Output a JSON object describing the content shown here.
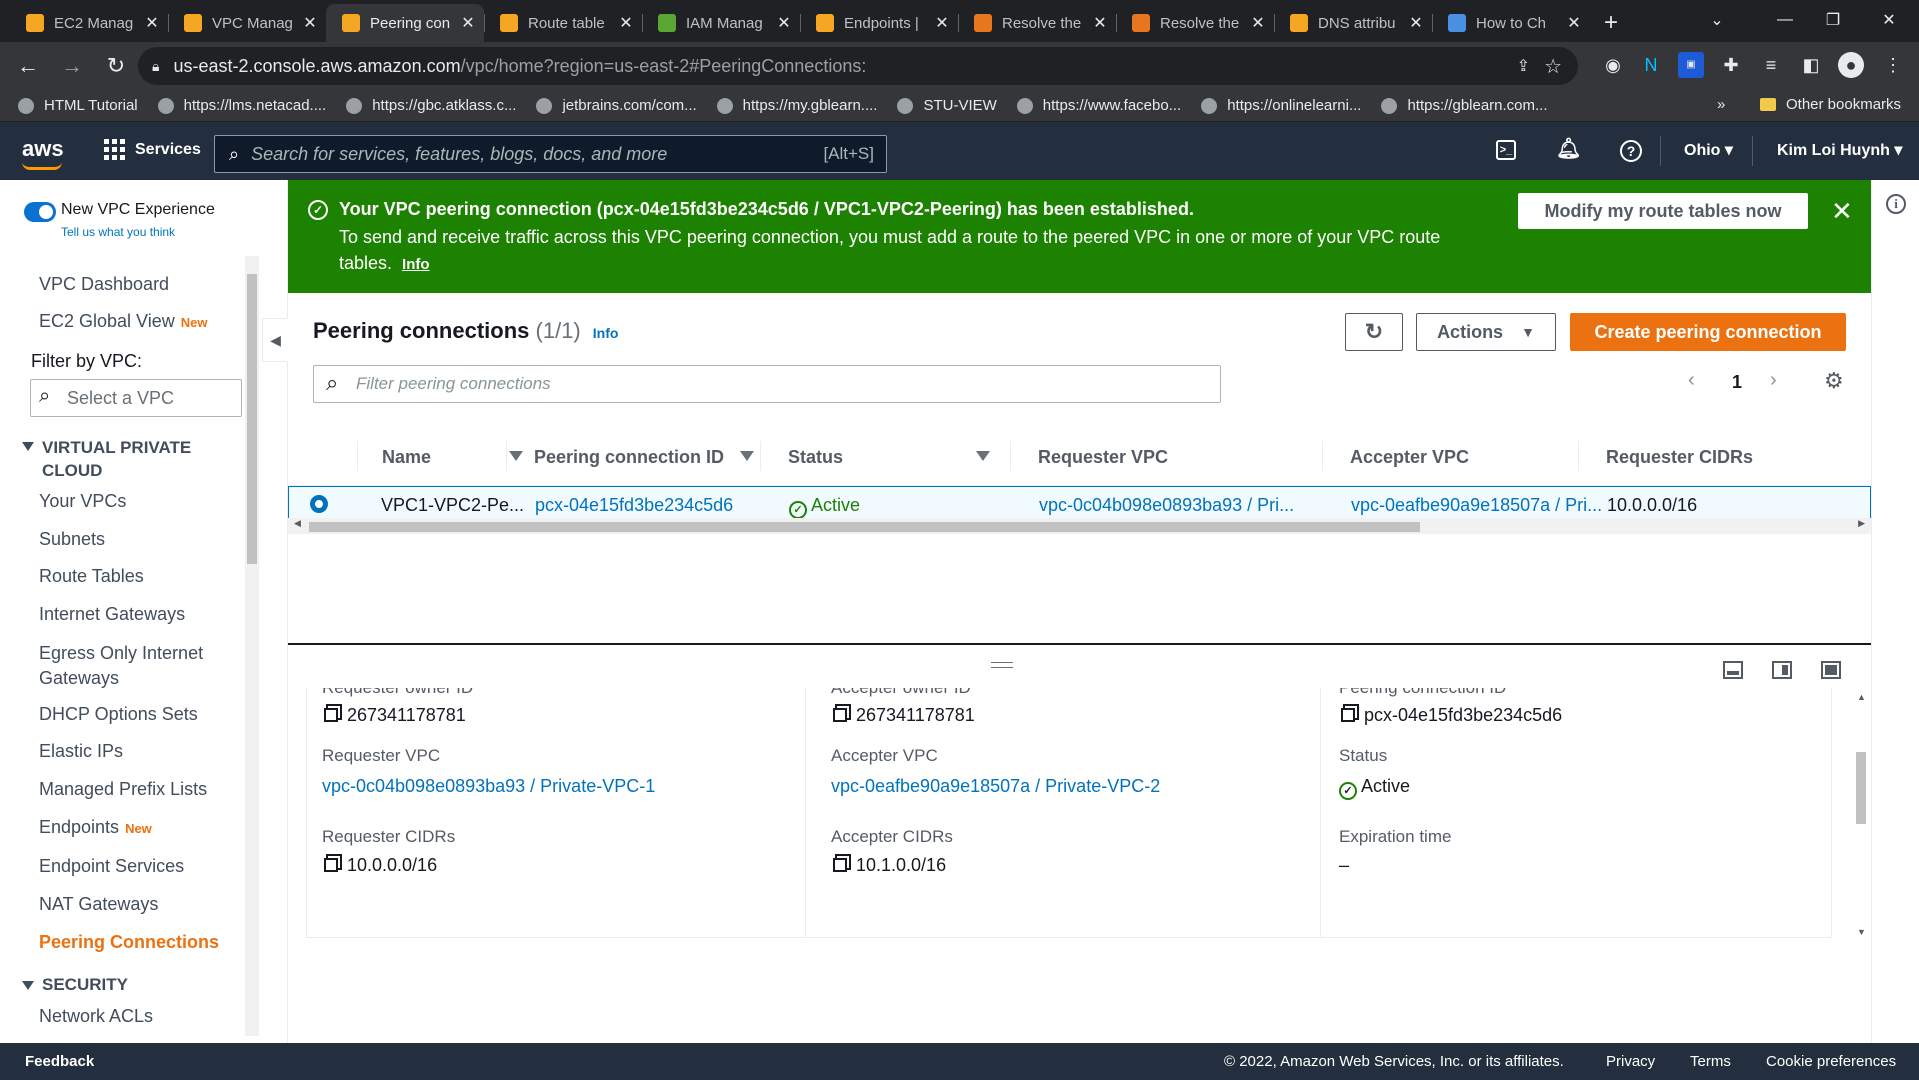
{
  "browser": {
    "tabs": [
      {
        "title": "EC2 Manag",
        "color": "#f5a623"
      },
      {
        "title": "VPC Manag",
        "color": "#f5a623"
      },
      {
        "title": "Peering con",
        "color": "#f5a623",
        "active": true
      },
      {
        "title": "Route table",
        "color": "#f5a623"
      },
      {
        "title": "IAM Manag",
        "color": "#5aa832"
      },
      {
        "title": "Endpoints |",
        "color": "#f5a623"
      },
      {
        "title": "Resolve the",
        "color": "#e8761f"
      },
      {
        "title": "Resolve the",
        "color": "#e8761f"
      },
      {
        "title": "DNS attribu",
        "color": "#f5a623"
      },
      {
        "title": "How to Ch",
        "color": "#4a90e2"
      }
    ],
    "url_host": "us-east-2.console.aws.amazon.com",
    "url_path": "/vpc/home?region=us-east-2#PeeringConnections:",
    "bookmarks": [
      "HTML Tutorial",
      "https://lms.netacad....",
      "https://gbc.atklass.c...",
      "jetbrains.com/com...",
      "https://my.gblearn....",
      "STU-VIEW",
      "https://www.facebo...",
      "https://onlinelearni...",
      "https://gblearn.com..."
    ],
    "other_bookmarks": "Other bookmarks",
    "more_chevron": "»"
  },
  "aws_nav": {
    "logo": "aws",
    "services": "Services",
    "search_placeholder": "Search for services, features, blogs, docs, and more",
    "search_shortcut": "[Alt+S]",
    "region": "Ohio",
    "user": "Kim Loi Huynh"
  },
  "sidebar": {
    "new_vpc_experience": "New VPC Experience",
    "feedback_link": "Tell us what you think",
    "dashboard": "VPC Dashboard",
    "ec2_global_view": "EC2 Global View",
    "new_badge": "New",
    "filter_label": "Filter by VPC:",
    "filter_placeholder": "Select a VPC",
    "section_vpc_line1": "VIRTUAL PRIVATE",
    "section_vpc_line2": "CLOUD",
    "items": [
      "Your VPCs",
      "Subnets",
      "Route Tables",
      "Internet Gateways",
      "Egress Only Internet",
      "Gateways",
      "DHCP Options Sets",
      "Elastic IPs",
      "Managed Prefix Lists",
      "Endpoints",
      "Endpoint Services",
      "NAT Gateways",
      "Peering Connections"
    ],
    "section_security": "SECURITY",
    "security_items": [
      "Network ACLs"
    ]
  },
  "flash": {
    "title": "Your VPC peering connection (pcx-04e15fd3be234c5d6 / VPC1-VPC2-Peering) has been established.",
    "message": "To send and receive traffic across this VPC peering connection, you must add a route to the peered VPC in one or more of your VPC route tables.",
    "info": "Info",
    "action": "Modify my route tables now",
    "color": "#1d8102"
  },
  "page": {
    "title": "Peering connections",
    "count": "(1/1)",
    "info": "Info",
    "actions": "Actions",
    "create": "Create peering connection",
    "filter_placeholder": "Filter peering connections",
    "page_number": "1"
  },
  "table": {
    "columns": [
      "Name",
      "Peering connection ID",
      "Status",
      "Requester VPC",
      "Accepter VPC",
      "Requester CIDRs"
    ],
    "rows": [
      {
        "name": "VPC1-VPC2-Pe...",
        "id": "pcx-04e15fd3be234c5d6",
        "status": "Active",
        "requester_vpc": "vpc-0c04b098e0893ba93 / Pri...",
        "accepter_vpc": "vpc-0eafbe90a9e18507a / Pri...",
        "requester_cidrs": "10.0.0.0/16"
      }
    ]
  },
  "details": {
    "requester_owner_label": "Requester owner ID",
    "requester_owner": "267341178781",
    "accepter_owner_label": "Accepter owner ID",
    "accepter_owner": "267341178781",
    "peering_id_label": "Peering connection ID",
    "peering_id": "pcx-04e15fd3be234c5d6",
    "requester_vpc_label": "Requester VPC",
    "requester_vpc": "vpc-0c04b098e0893ba93 / Private-VPC-1",
    "accepter_vpc_label": "Accepter VPC",
    "accepter_vpc": "vpc-0eafbe90a9e18507a / Private-VPC-2",
    "status_label": "Status",
    "status": "Active",
    "requester_cidrs_label": "Requester CIDRs",
    "requester_cidrs": "10.0.0.0/16",
    "accepter_cidrs_label": "Accepter CIDRs",
    "accepter_cidrs": "10.1.0.0/16",
    "expiration_label": "Expiration time",
    "expiration": "–"
  },
  "footer": {
    "feedback": "Feedback",
    "copyright": "© 2022, Amazon Web Services, Inc. or its affiliates.",
    "privacy": "Privacy",
    "terms": "Terms",
    "cookies": "Cookie preferences"
  }
}
